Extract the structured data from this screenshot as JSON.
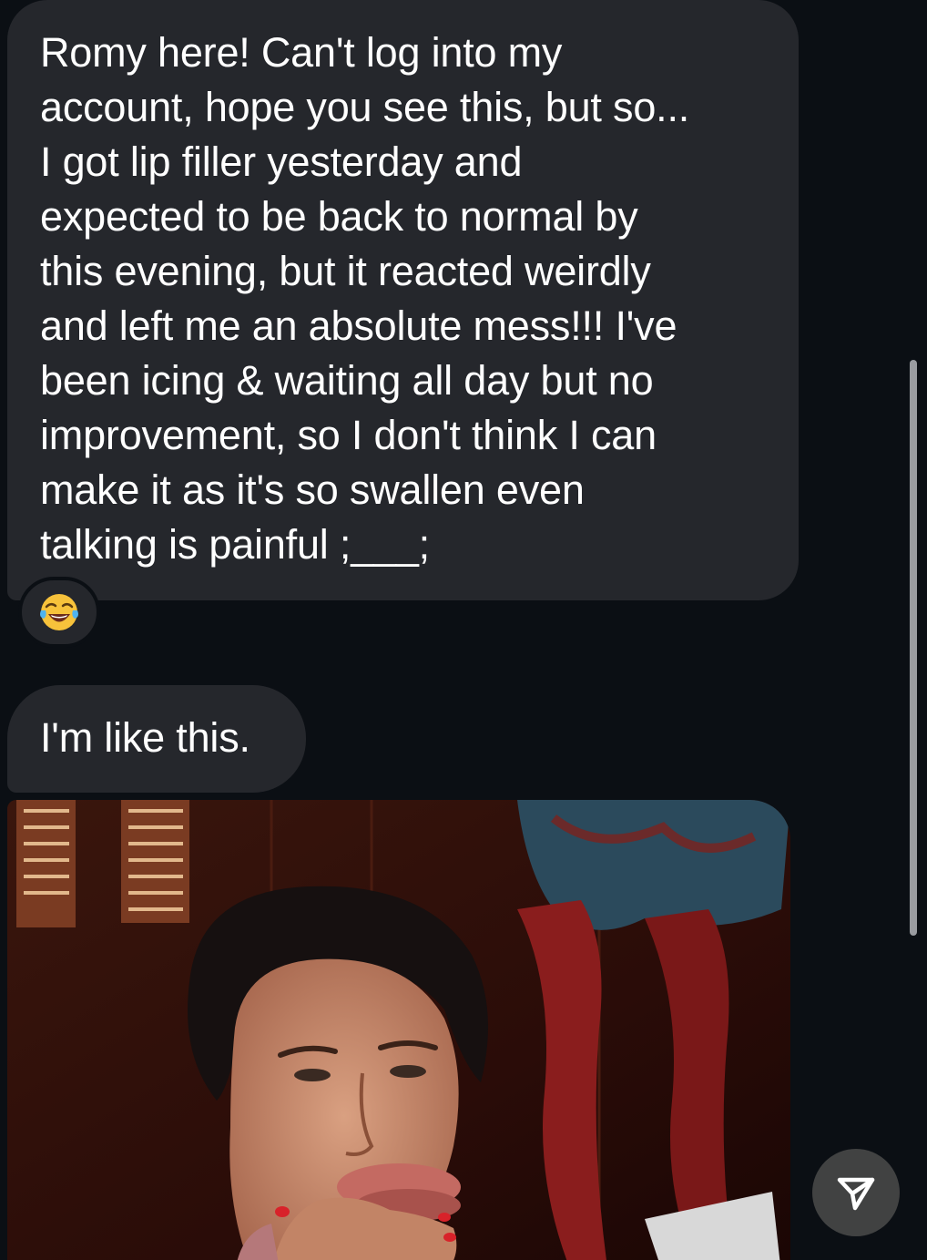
{
  "messages": [
    {
      "text": "Romy here! Can't log into my\naccount, hope you see this, but so...\nI got lip filler yesterday and\nexpected to be back to normal by\nthis evening, but it reacted weirdly\nand left me an absolute mess!!! I've\nbeen icing & waiting all day but no\nimprovement, so I don't think I can\nmake it as it's so swallen even\ntalking is painful ;___;",
      "reaction": "face-with-tears-of-joy-icon"
    },
    {
      "text": "I'm like this."
    }
  ],
  "attachment": {
    "type": "photo",
    "icon": "photo-attachment"
  },
  "controls": {
    "send_icon": "send-icon"
  },
  "colors": {
    "background": "#0b0f14",
    "bubble": "#25272c",
    "text": "#ffffff",
    "scrollbar": "#9a9ca1"
  }
}
